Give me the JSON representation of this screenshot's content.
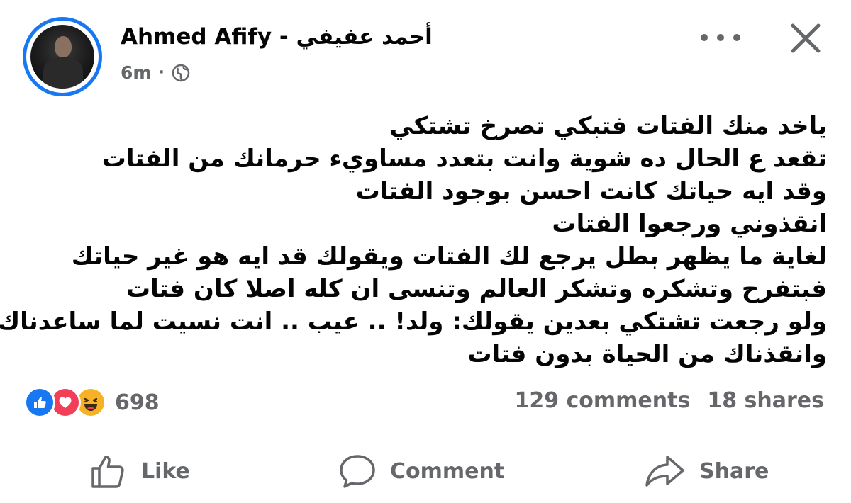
{
  "post": {
    "author_name": "Ahmed Afify - أحمد عفيفي",
    "time": "6m",
    "separator": "·",
    "privacy_icon": "globe-icon",
    "text_lines": [
      "ياخد منك الفتات فتبكي تصرخ تشتكي",
      "تقعد ع الحال ده شوية وانت بتعدد مساويء حرمانك من الفتات",
      "وقد ايه حياتك كانت احسن بوجود الفتات",
      "انقذوني ورجعوا الفتات",
      "لغاية ما يظهر بطل يرجع لك الفتات ويقولك قد ايه هو غير حياتك",
      "فبتفرح وتشكره وتشكر العالم وتنسى ان كله اصلا كان فتات",
      "ولو رجعت تشتكي بعدين يقولك: ولد! .. عيب .. انت نسيت لما ساعدناك",
      "وانقذناك من الحياة بدون فتات"
    ]
  },
  "reactions": {
    "icons": [
      "like-icon",
      "love-icon",
      "haha-icon"
    ],
    "count": "698"
  },
  "stats": {
    "comments": "129 comments",
    "shares": "18 shares"
  },
  "actions": {
    "like_label": "Like",
    "comment_label": "Comment",
    "share_label": "Share"
  },
  "colors": {
    "accent": "#1877f2",
    "love": "#f33e58",
    "haha": "#f7b125",
    "secondary_text": "#65676b"
  }
}
